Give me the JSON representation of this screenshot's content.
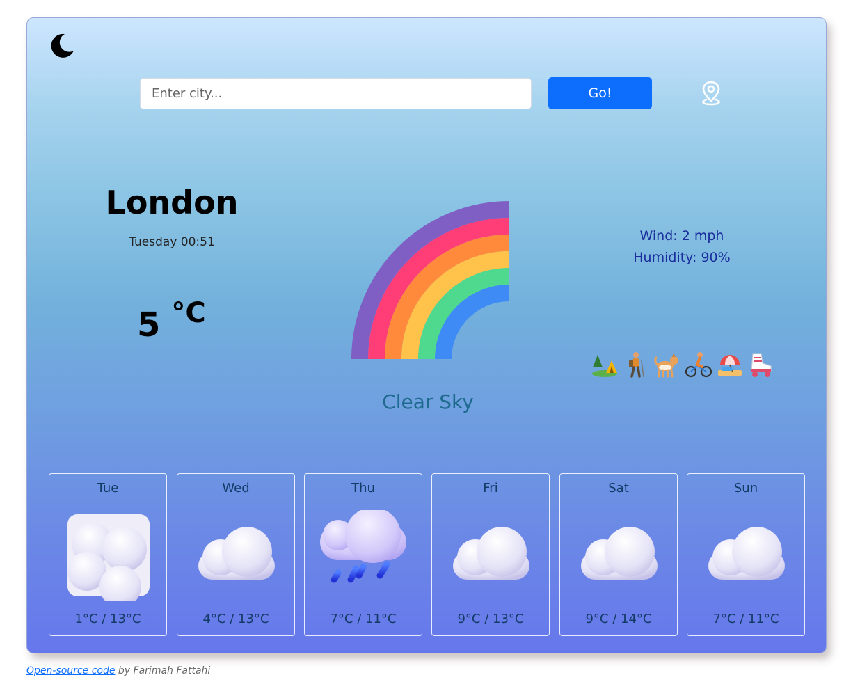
{
  "search": {
    "placeholder": "Enter city...",
    "value": "",
    "button_label": "Go!"
  },
  "icons": {
    "theme_toggle": "moon-icon",
    "location": "map-pin-icon"
  },
  "current": {
    "city": "London",
    "datetime": "Tuesday 00:51",
    "temperature": "5",
    "unit": "°C",
    "condition_icon": "rainbow-icon",
    "description": "Clear Sky",
    "wind": "Wind: 2 mph",
    "humidity": "Humidity: 90%"
  },
  "activities": [
    "camping-icon",
    "hiking-icon",
    "dog-walking-icon",
    "cycling-icon",
    "beach-icon",
    "roller-skating-icon"
  ],
  "forecast": [
    {
      "day": "Tue",
      "range": "1°C / 13°C",
      "icon": "overcast-clouds-icon"
    },
    {
      "day": "Wed",
      "range": "4°C / 13°C",
      "icon": "cloud-icon"
    },
    {
      "day": "Thu",
      "range": "7°C / 11°C",
      "icon": "rain-cloud-icon"
    },
    {
      "day": "Fri",
      "range": "9°C / 13°C",
      "icon": "cloud-icon"
    },
    {
      "day": "Sat",
      "range": "9°C / 14°C",
      "icon": "cloud-icon"
    },
    {
      "day": "Sun",
      "range": "7°C / 11°C",
      "icon": "cloud-icon"
    }
  ],
  "footer": {
    "link_text": "Open-source code",
    "suffix": " by Farimah Fattahi"
  },
  "colors": {
    "accent": "#0d6efd",
    "description": "#1e6a8e",
    "stats": "#1a2d9c",
    "forecast_text": "#123b66"
  }
}
